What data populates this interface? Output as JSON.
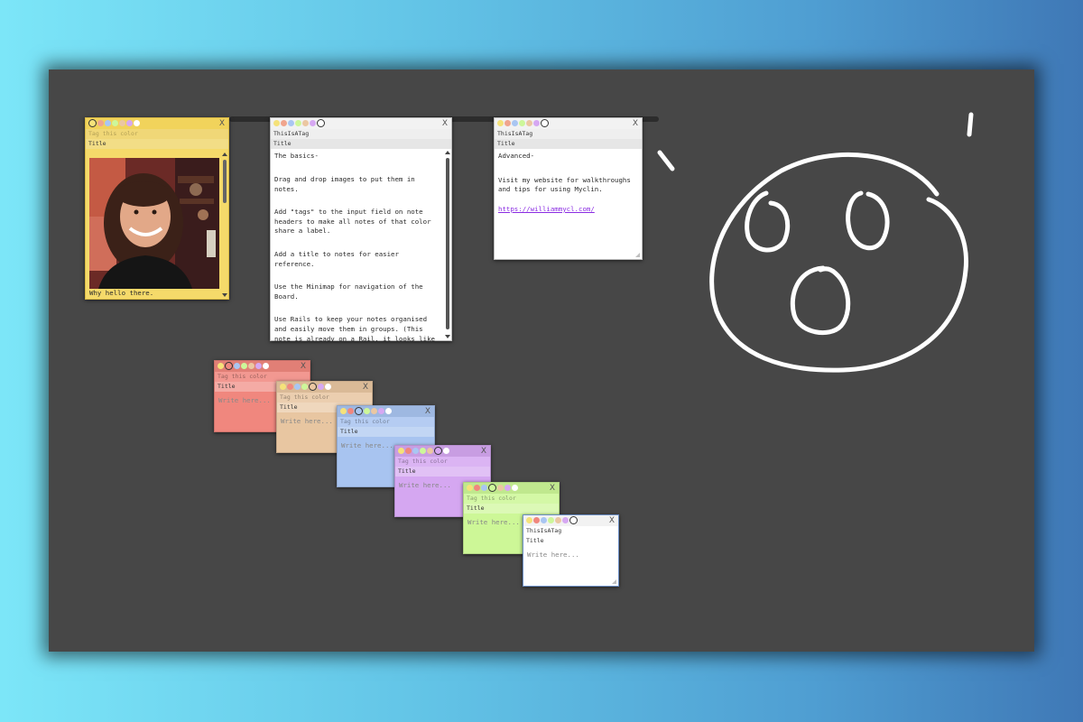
{
  "palette": {
    "yellow": "#f5e27a",
    "orange": "#e99a8f",
    "red": "#f2877d",
    "tan": "#ebc7a2",
    "blue": "#a9c6f2",
    "purple": "#d6a8f2",
    "green": "#cdf79a",
    "white": "#ffffff"
  },
  "photo_note": {
    "color": "#f5da6a",
    "tag_placeholder": "Tag this color",
    "title": "Title",
    "close": "X",
    "image": "photo-of-smiling-man",
    "caption": "Why hello there."
  },
  "basics_note": {
    "tag": "ThisIsATag",
    "title": "Title",
    "close": "X",
    "lines": [
      "The basics-",
      "",
      "Drag and drop images to put them in notes.",
      "",
      "Add \"tags\" to the input field on note headers to make all notes of that color share a label.",
      "",
      "Add a title to notes for easier reference.",
      "",
      "Use the Minimap for navigation of the Board.",
      "",
      "Use Rails to keep your notes organised and easily move them in groups. (This note is already on a Rail, it looks like a thin bar the same color as the background. Try selecting the Rail and dragging to move it"
    ]
  },
  "advanced_note": {
    "tag": "ThisIsATag",
    "title": "Title",
    "close": "X",
    "heading": "Advanced-",
    "text": "Visit my website for walkthroughs and tips for using Myclin.",
    "link": "https://williammycl.com/"
  },
  "stack_notes": [
    {
      "color": "#f0877e",
      "tag": "Tag this color",
      "title": "Title",
      "body": "Write here...",
      "close": "X"
    },
    {
      "color": "#e8c6a1",
      "tag": "Tag this color",
      "title": "Title",
      "body": "Write here...",
      "close": "X"
    },
    {
      "color": "#a8c4f0",
      "tag": "Tag this color",
      "title": "Title",
      "body": "Write here...",
      "close": "X"
    },
    {
      "color": "#d5a7f1",
      "tag": "Tag this color",
      "title": "Title",
      "body": "Write here...",
      "close": "X"
    },
    {
      "color": "#cdf797",
      "tag": "Tag this color",
      "title": "Title",
      "body": "Write here...",
      "close": "X"
    },
    {
      "color": "#ffffff",
      "tag": "ThisIsATag",
      "title": "Title",
      "body": "Write here...",
      "close": "X"
    }
  ],
  "drawing": "surprised-face-doodle"
}
